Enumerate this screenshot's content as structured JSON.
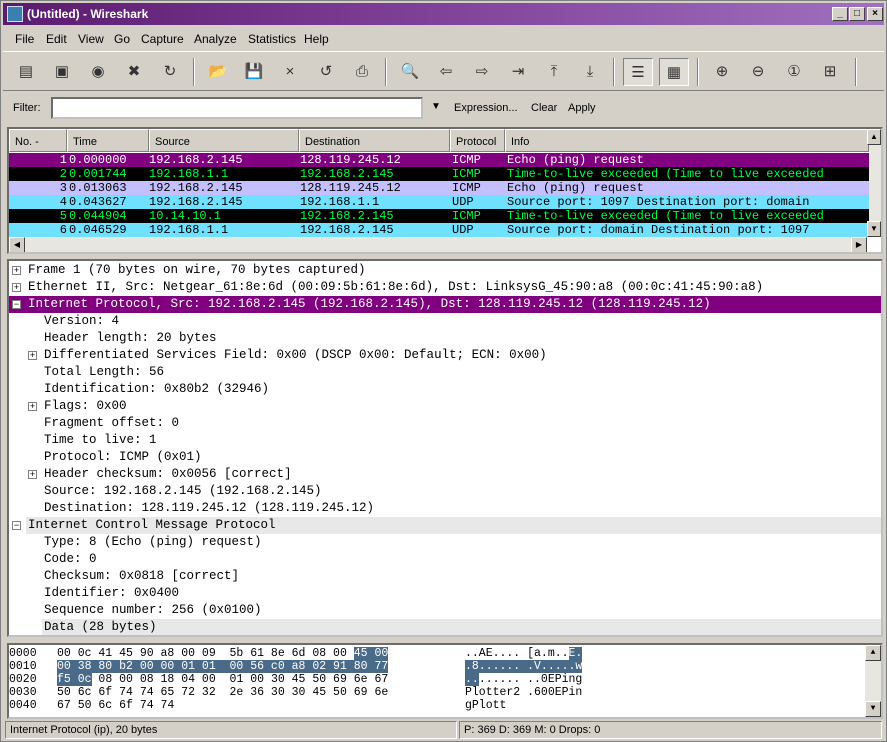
{
  "window": {
    "title": "(Untitled) - Wireshark"
  },
  "menu": [
    "File",
    "Edit",
    "View",
    "Go",
    "Capture",
    "Analyze",
    "Statistics",
    "Help"
  ],
  "filter": {
    "label": "Filter:",
    "value": "",
    "expression": "Expression...",
    "clear": "Clear",
    "apply": "Apply"
  },
  "columns": [
    "No. -",
    "Time",
    "Source",
    "Destination",
    "Protocol",
    "Info"
  ],
  "packets": [
    {
      "no": "1",
      "time": "0.000000",
      "src": "192.168.2.145",
      "dst": "128.119.245.12",
      "proto": "ICMP",
      "info": "Echo (ping) request",
      "bg": "#800080",
      "fg": "#ffffff"
    },
    {
      "no": "2",
      "time": "0.001744",
      "src": "192.168.1.1",
      "dst": "192.168.2.145",
      "proto": "ICMP",
      "info": "Time-to-live exceeded (Time to live exceeded",
      "bg": "#000000",
      "fg": "#00ff40"
    },
    {
      "no": "3",
      "time": "0.013063",
      "src": "192.168.2.145",
      "dst": "128.119.245.12",
      "proto": "ICMP",
      "info": "Echo (ping) request",
      "bg": "#c4c0ff",
      "fg": "#000000"
    },
    {
      "no": "4",
      "time": "0.043627",
      "src": "192.168.2.145",
      "dst": "192.168.1.1",
      "proto": "UDP",
      "info": "Source port: 1097  Destination port: domain",
      "bg": "#70e0ff",
      "fg": "#000000"
    },
    {
      "no": "5",
      "time": "0.044904",
      "src": "10.14.10.1",
      "dst": "192.168.2.145",
      "proto": "ICMP",
      "info": "Time-to-live exceeded (Time to live exceeded",
      "bg": "#000000",
      "fg": "#00ff40"
    },
    {
      "no": "6",
      "time": "0.046529",
      "src": "192.168.1.1",
      "dst": "192.168.2.145",
      "proto": "UDP",
      "info": "Source port: domain  Destination port: 1097",
      "bg": "#70e0ff",
      "fg": "#000000"
    }
  ],
  "details": [
    {
      "indent": 0,
      "exp": "+",
      "text": "Frame 1 (70 bytes on wire, 70 bytes captured)",
      "style": "normal"
    },
    {
      "indent": 0,
      "exp": "+",
      "text": "Ethernet II, Src: Netgear_61:8e:6d (00:09:5b:61:8e:6d), Dst: LinksysG_45:90:a8 (00:0c:41:45:90:a8)",
      "style": "normal"
    },
    {
      "indent": 0,
      "exp": "-",
      "text": "Internet Protocol, Src: 192.168.2.145 (192.168.2.145), Dst: 128.119.245.12 (128.119.245.12)",
      "style": "selected"
    },
    {
      "indent": 1,
      "exp": "",
      "text": "Version: 4",
      "style": "normal"
    },
    {
      "indent": 1,
      "exp": "",
      "text": "Header length: 20 bytes",
      "style": "normal"
    },
    {
      "indent": 1,
      "exp": "+",
      "text": "Differentiated Services Field: 0x00 (DSCP 0x00: Default; ECN: 0x00)",
      "style": "normal"
    },
    {
      "indent": 1,
      "exp": "",
      "text": "Total Length: 56",
      "style": "normal"
    },
    {
      "indent": 1,
      "exp": "",
      "text": "Identification: 0x80b2 (32946)",
      "style": "normal"
    },
    {
      "indent": 1,
      "exp": "+",
      "text": "Flags: 0x00",
      "style": "normal"
    },
    {
      "indent": 1,
      "exp": "",
      "text": "Fragment offset: 0",
      "style": "normal"
    },
    {
      "indent": 1,
      "exp": "",
      "text": "Time to live: 1",
      "style": "normal"
    },
    {
      "indent": 1,
      "exp": "",
      "text": "Protocol: ICMP (0x01)",
      "style": "normal"
    },
    {
      "indent": 1,
      "exp": "+",
      "text": "Header checksum: 0x0056 [correct]",
      "style": "normal"
    },
    {
      "indent": 1,
      "exp": "",
      "text": "Source: 192.168.2.145 (192.168.2.145)",
      "style": "normal"
    },
    {
      "indent": 1,
      "exp": "",
      "text": "Destination: 128.119.245.12 (128.119.245.12)",
      "style": "normal"
    },
    {
      "indent": 0,
      "exp": "-",
      "text": "Internet Control Message Protocol",
      "style": "grey"
    },
    {
      "indent": 1,
      "exp": "",
      "text": "Type: 8 (Echo (ping) request)",
      "style": "normal"
    },
    {
      "indent": 1,
      "exp": "",
      "text": "Code: 0",
      "style": "normal"
    },
    {
      "indent": 1,
      "exp": "",
      "text": "Checksum: 0x0818 [correct]",
      "style": "normal"
    },
    {
      "indent": 1,
      "exp": "",
      "text": "Identifier: 0x0400",
      "style": "normal"
    },
    {
      "indent": 1,
      "exp": "",
      "text": "Sequence number: 256 (0x0100)",
      "style": "normal"
    },
    {
      "indent": 1,
      "exp": "",
      "text": "Data (28 bytes)",
      "style": "grey"
    }
  ],
  "hexdump": [
    {
      "offset": "0000",
      "hex": [
        [
          "00 0c 41 45 90 a8 00 09  5b 61 8e 6d 08 00 ",
          false
        ],
        [
          "45 00",
          true
        ]
      ],
      "ascii": [
        [
          "..AE.... [a.m..",
          false
        ],
        [
          "E.",
          true
        ]
      ]
    },
    {
      "offset": "0010",
      "hex": [
        [
          "00 38 80 b2 00 00 01 01  00 56 c0 a8 02 91 80 77",
          true
        ]
      ],
      "ascii": [
        [
          ".8...... .V.....w",
          true
        ]
      ]
    },
    {
      "offset": "0020",
      "hex": [
        [
          "f5 0c",
          true
        ],
        [
          " 08 00 08 18 04 00  01 00 30 45 50 69 6e 67",
          false
        ]
      ],
      "ascii": [
        [
          "..",
          true
        ],
        [
          "...... ..0EPing",
          false
        ]
      ]
    },
    {
      "offset": "0030",
      "hex": [
        [
          "50 6c 6f 74 74 65 72 32  2e 36 30 30 45 50 69 6e",
          false
        ]
      ],
      "ascii": [
        [
          "Plotter2 .600EPin",
          false
        ]
      ]
    },
    {
      "offset": "0040",
      "hex": [
        [
          "67 50 6c 6f 74 74",
          false
        ]
      ],
      "ascii": [
        [
          "gPlott",
          false
        ]
      ]
    }
  ],
  "status": {
    "left": "Internet Protocol (ip), 20 bytes",
    "right": "P: 369 D: 369 M: 0 Drops: 0"
  },
  "colors": {
    "selected": "#800080",
    "hexsel": "#4a6a8a",
    "grey": "#e8e8e8"
  }
}
